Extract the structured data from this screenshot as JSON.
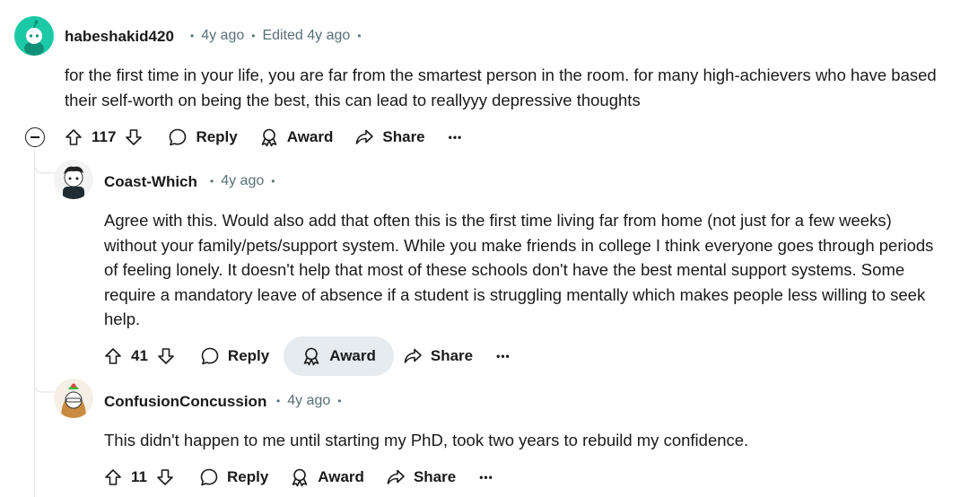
{
  "comments": [
    {
      "username": "habeshakid420",
      "time": "4y ago",
      "edited": "Edited 4y ago",
      "body": "for the first time in your life, you are far from the smartest person in the room. for many high-achievers who have based their self-worth on being the best, this can lead to reallyyy depressive thoughts",
      "score": "117",
      "reply_label": "Reply",
      "award_label": "Award",
      "share_label": "Share",
      "more_label": "•••",
      "avatar_color": "#1cc9a7"
    },
    {
      "username": "Coast-Which",
      "time": "4y ago",
      "body": "Agree with this. Would also add that often this is the first time living far from home (not just for a few weeks) without your family/pets/support system. While you make friends in college I think everyone goes through periods of feeling lonely. It doesn't help that most of these schools don't have the best mental support systems. Some require a mandatory leave of absence if a student is struggling mentally which makes people less willing to seek help.",
      "score": "41",
      "reply_label": "Reply",
      "award_label": "Award",
      "share_label": "Share",
      "more_label": "•••"
    },
    {
      "username": "ConfusionConcussion",
      "time": "4y ago",
      "body": "This didn't happen to me until starting my PhD, took two years to rebuild my confidence.",
      "score": "11",
      "reply_label": "Reply",
      "award_label": "Award",
      "share_label": "Share",
      "more_label": "•••"
    }
  ],
  "colors": {
    "meta_text": "#576f76",
    "active_button_bg": "#e5ebee",
    "thread_line": "#e3e5e8"
  }
}
